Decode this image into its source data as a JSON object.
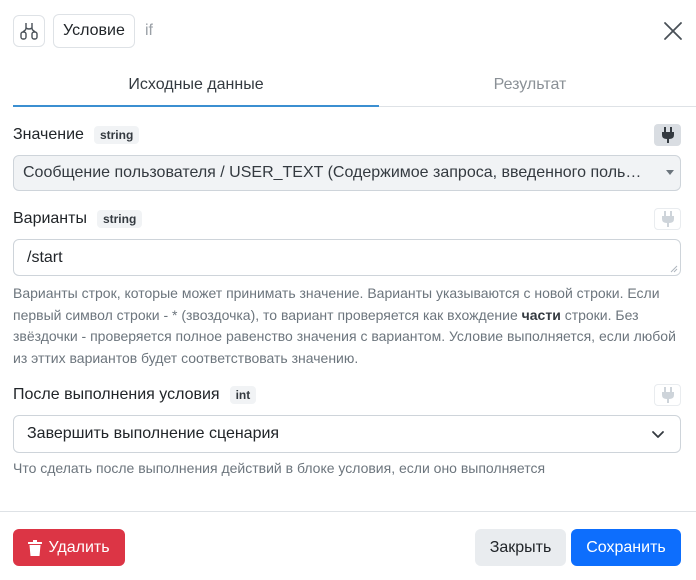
{
  "header": {
    "node_icon": "branch-icon",
    "title": "Условие",
    "subtitle": "if",
    "close_icon": "close-icon"
  },
  "tabs": [
    {
      "label": "Исходные данные",
      "active": true
    },
    {
      "label": "Результат",
      "active": false
    }
  ],
  "fields": {
    "value": {
      "label": "Значение",
      "type": "string",
      "selected": "Сообщение пользователя / USER_TEXT (Содержимое запроса, введенного пользователем)",
      "plug_active": true
    },
    "variants": {
      "label": "Варианты",
      "type": "string",
      "value": "/start",
      "plug_active": false,
      "help_1": "Варианты строк, которые может принимать значение. Варианты указываются с новой строки. Если первый символ строки - * (звоздочка), то вариант проверяется как вхождение ",
      "help_bold": "части",
      "help_2": " строки. Без звёздочки - проверяется полное равенство значения с вариантом. Условие выполняется, если любой из эттих вариантов будет соответствовать значению."
    },
    "after": {
      "label": "После выполнения условия",
      "type": "int",
      "selected": "Завершить выполнение сценария",
      "plug_active": false,
      "help": "Что сделать после выполнения действий в блоке условия, если оно выполняется"
    }
  },
  "footer": {
    "delete_label": "Удалить",
    "close_label": "Закрыть",
    "save_label": "Сохранить"
  },
  "colors": {
    "accent": "#0d6efd",
    "danger": "#dc3545",
    "tab_underline": "#3b8fd1"
  }
}
